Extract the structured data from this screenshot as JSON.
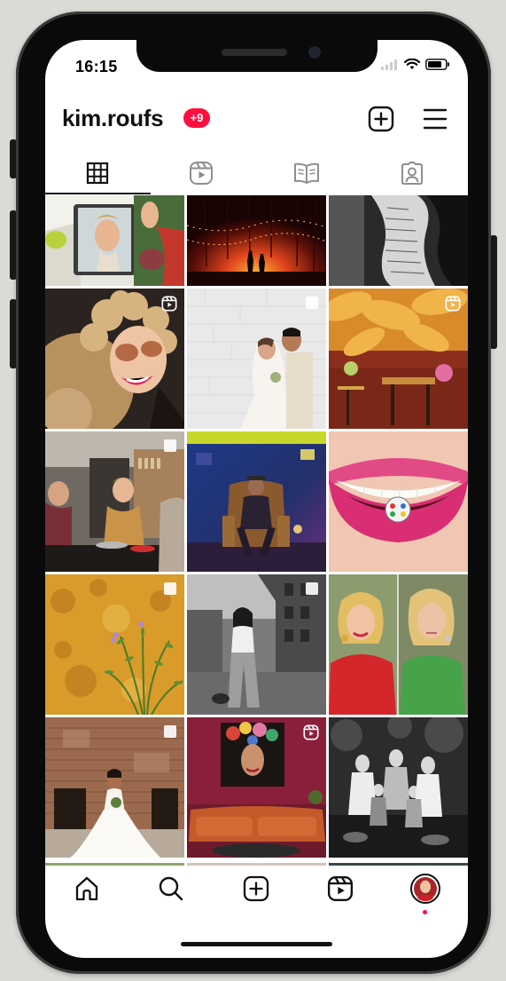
{
  "theme": {
    "background": "#d9dbd6",
    "badge_color": "#ff0f3e",
    "text_color": "#111111"
  },
  "status_bar": {
    "time": "16:15",
    "icons": [
      "signal-icon",
      "wifi-icon",
      "battery-icon"
    ]
  },
  "header": {
    "username": "kim.roufs",
    "notification_badge": "+9",
    "actions": [
      {
        "name": "new-post-icon",
        "label": ""
      },
      {
        "name": "menu-icon",
        "label": ""
      }
    ]
  },
  "profile_tabs": [
    {
      "name": "posts-grid-tab",
      "icon": "grid-icon",
      "active": true
    },
    {
      "name": "reels-tab",
      "icon": "reels-icon",
      "active": false
    },
    {
      "name": "guides-tab",
      "icon": "book-icon",
      "active": false
    },
    {
      "name": "tagged-tab",
      "icon": "tagged-person-icon",
      "active": false
    }
  ],
  "posts": [
    {
      "subject": "woman with mirror",
      "badge": null
    },
    {
      "subject": "couple under string lights",
      "badge": null
    },
    {
      "subject": "body painted text",
      "badge": null
    },
    {
      "subject": "curly hair woman sunglasses",
      "badge": "reel"
    },
    {
      "subject": "wedding couple kiss",
      "badge": "carousel"
    },
    {
      "subject": "restaurant orange feathers",
      "badge": "reel"
    },
    {
      "subject": "kitchen cooking",
      "badge": "carousel"
    },
    {
      "subject": "man in leather chair",
      "badge": null
    },
    {
      "subject": "smile with ring",
      "badge": null
    },
    {
      "subject": "orange wall plant",
      "badge": "carousel"
    },
    {
      "subject": "black white woman street",
      "badge": "carousel"
    },
    {
      "subject": "woman red and green portraits",
      "badge": null
    },
    {
      "subject": "bride brick ruin",
      "badge": "carousel"
    },
    {
      "subject": "living room portrait painting",
      "badge": "reel"
    },
    {
      "subject": "family black white",
      "badge": null
    }
  ],
  "bottom_nav": [
    {
      "name": "home-icon"
    },
    {
      "name": "search-icon"
    },
    {
      "name": "create-icon"
    },
    {
      "name": "reels-icon"
    },
    {
      "name": "profile-avatar"
    }
  ]
}
